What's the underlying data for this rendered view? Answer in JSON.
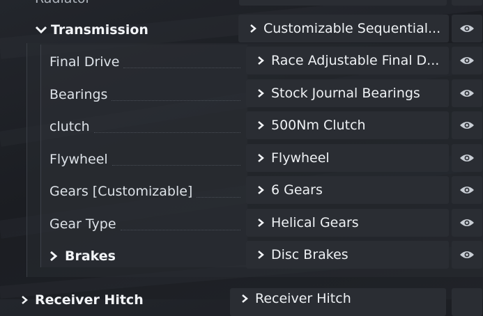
{
  "top_row": {
    "label": "Radiator"
  },
  "transmission": {
    "label": "Transmission",
    "part": "Customizable Sequential..."
  },
  "rows": [
    {
      "label": "Final Drive",
      "part": "Race Adjustable Final D..."
    },
    {
      "label": "Bearings",
      "part": "Stock Journal Bearings"
    },
    {
      "label": "clutch",
      "part": "500Nm Clutch"
    },
    {
      "label": "Flywheel",
      "part": "Flywheel"
    },
    {
      "label": "Gears [Customizable]",
      "part": "6 Gears"
    },
    {
      "label": "Gear Type",
      "part": "Helical Gears"
    },
    {
      "label": "Brakes",
      "part": "Disc Brakes"
    }
  ],
  "bottom_row": {
    "label": "Receiver Hitch",
    "part": "Receiver Hitch"
  },
  "icons": {
    "expand": "chevron-down-icon",
    "collapsed": "chevron-right-icon",
    "visibility": "eye-icon"
  },
  "colors": {
    "background": "#1e2025",
    "slot": "#2a2d33",
    "text": "#e8ecf1"
  }
}
